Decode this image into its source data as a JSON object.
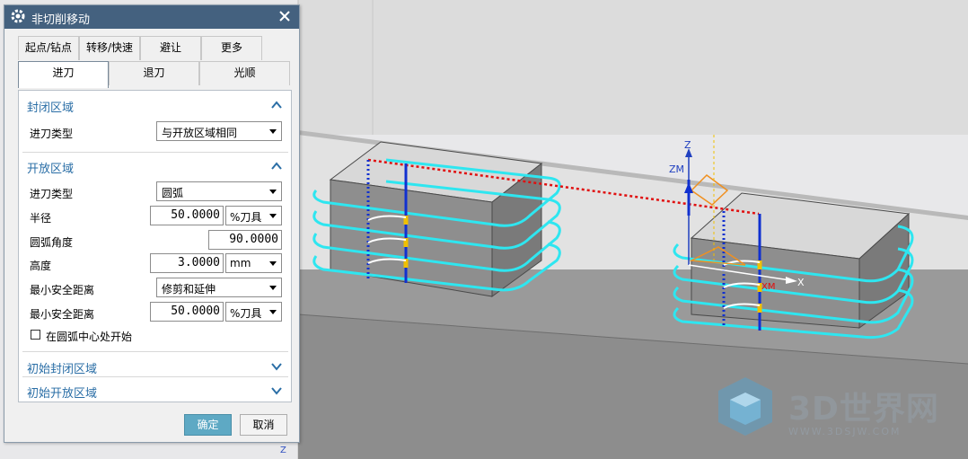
{
  "dialog": {
    "title": "非切削移动",
    "close_glyph": "✕",
    "tabs_row1": [
      "起点/钻点",
      "转移/快速",
      "避让",
      "更多"
    ],
    "tabs_row2": [
      "进刀",
      "退刀",
      "光顺"
    ],
    "active_tab": "进刀",
    "closed_area": {
      "header": "封闭区域",
      "engage_type_label": "进刀类型",
      "engage_type_value": "与开放区域相同"
    },
    "open_area": {
      "header": "开放区域",
      "engage_type_label": "进刀类型",
      "engage_type_value": "圆弧",
      "radius_label": "半径",
      "radius_value": "50.0000",
      "radius_unit": "%刀具",
      "arc_angle_label": "圆弧角度",
      "arc_angle_value": "90.0000",
      "height_label": "高度",
      "height_value": "3.0000",
      "height_unit": "mm",
      "min_safe_label": "最小安全距离",
      "min_safe_mode": "修剪和延伸",
      "min_safe2_label": "最小安全距离",
      "min_safe2_value": "50.0000",
      "min_safe2_unit": "%刀具",
      "start_at_arc_center_label": "在圆弧中心处开始",
      "start_at_arc_center_checked": false
    },
    "initial_closed_header": "初始封闭区域",
    "initial_open_header": "初始开放区域",
    "ok_label": "确定",
    "cancel_label": "取消"
  },
  "viewport": {
    "axis_z": "Z",
    "axis_zm": "ZM",
    "axis_x": "X",
    "axis_xm": "XM",
    "axis_z_small": "Z"
  },
  "watermark": {
    "brand": "3D世界网",
    "url": "WWW.3DSJW.COM"
  },
  "colors": {
    "title_bar": "#44617f",
    "toolpath": "#2ee6f0",
    "engage_blue": "#1030d0",
    "rapid_red": "#e01010",
    "ok_button": "#5ea9c4",
    "section_header": "#2a6ea6"
  }
}
